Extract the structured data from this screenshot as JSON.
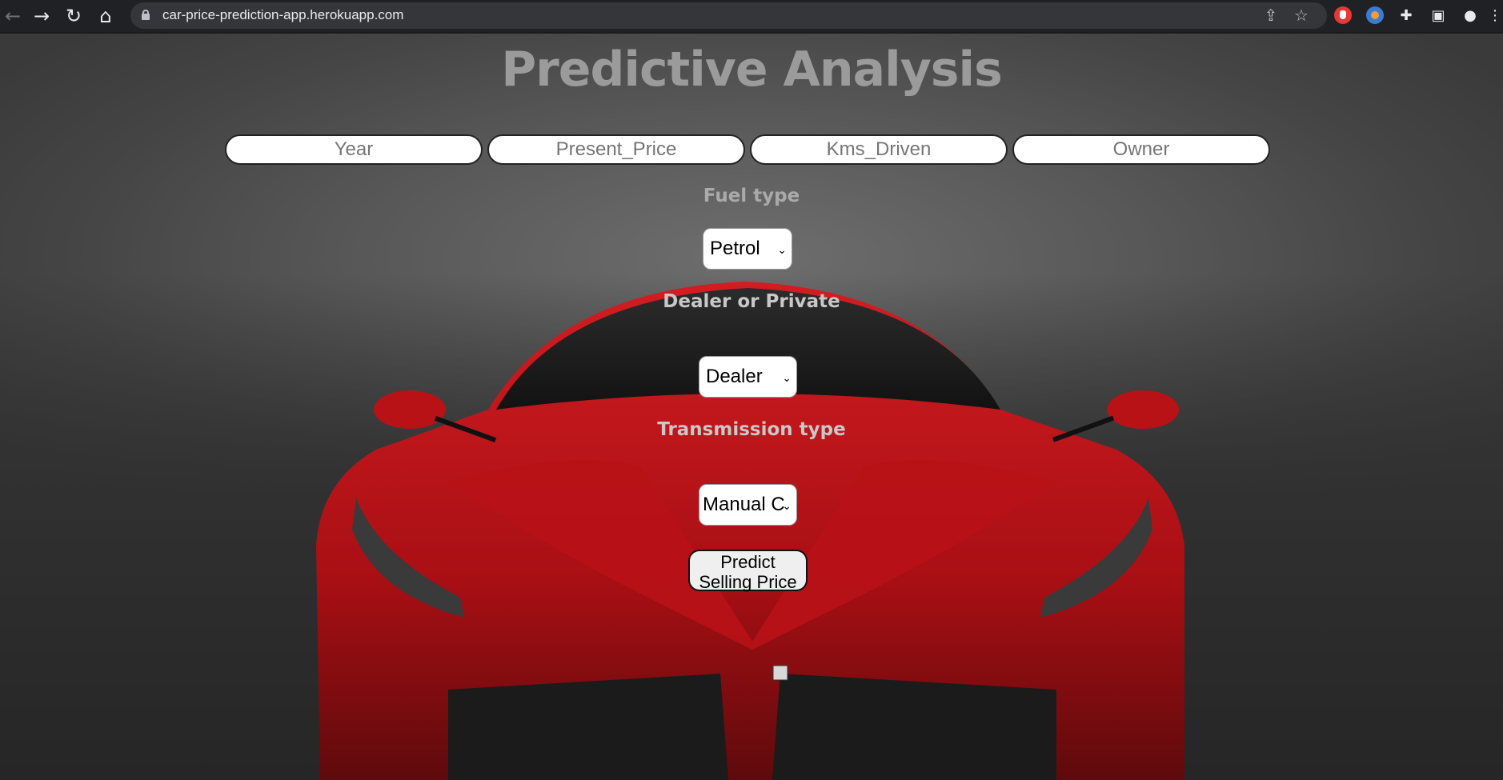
{
  "browser": {
    "url": "car-price-prediction-app.herokuapp.com"
  },
  "page": {
    "title": "Predictive Analysis",
    "inputs": [
      {
        "placeholder": "Year"
      },
      {
        "placeholder": "Present_Price"
      },
      {
        "placeholder": "Kms_Driven"
      },
      {
        "placeholder": "Owner"
      }
    ],
    "fuel": {
      "label": "Fuel type",
      "selected": "Petrol"
    },
    "seller": {
      "label": "Dealer or Private",
      "selected": "Dealer"
    },
    "transmission": {
      "label": "Transmission type",
      "selected": "Manual C"
    },
    "predict_button": {
      "line1": "Predict",
      "line2": "Selling Price"
    }
  },
  "colors": {
    "car_body": "#c4161c",
    "title_text": "#9b9b9b",
    "background": "#575757"
  }
}
